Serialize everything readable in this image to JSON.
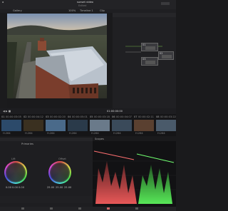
{
  "header": {
    "project_title": "sunset video",
    "project_subtitle": "Edited",
    "left_dropdown": "Gallery",
    "zoom_label": "100%",
    "clip_name_label": "Timeline 1",
    "viewer_mode": "Clip"
  },
  "viewer": {
    "timecode": "01:00:00:00"
  },
  "timeline": {
    "clips": [
      {
        "id": "01",
        "tc": "00:00:03:05",
        "codec": "H.264"
      },
      {
        "id": "02",
        "tc": "00:00:04:12",
        "codec": "H.264"
      },
      {
        "id": "03",
        "tc": "00:00:02:20",
        "codec": "H.264"
      },
      {
        "id": "04",
        "tc": "00:00:05:01",
        "codec": "H.264"
      },
      {
        "id": "05",
        "tc": "00:00:03:18",
        "codec": "H.264"
      },
      {
        "id": "06",
        "tc": "00:00:04:07",
        "codec": "H.264"
      },
      {
        "id": "07",
        "tc": "00:00:02:11",
        "codec": "H.264"
      },
      {
        "id": "08",
        "tc": "00:00:03:22",
        "codec": "H.264"
      }
    ]
  },
  "color": {
    "panel_title": "Primaries",
    "wheel_left_label": "Lift",
    "wheel_right_label": "Offset",
    "left_values": [
      "0.00",
      "0.00",
      "0.00"
    ],
    "right_values": [
      "25.00",
      "25.00",
      "25.00"
    ]
  },
  "scopes": {
    "title": "Scopes"
  },
  "nodes": [
    "01",
    "02",
    "03"
  ]
}
